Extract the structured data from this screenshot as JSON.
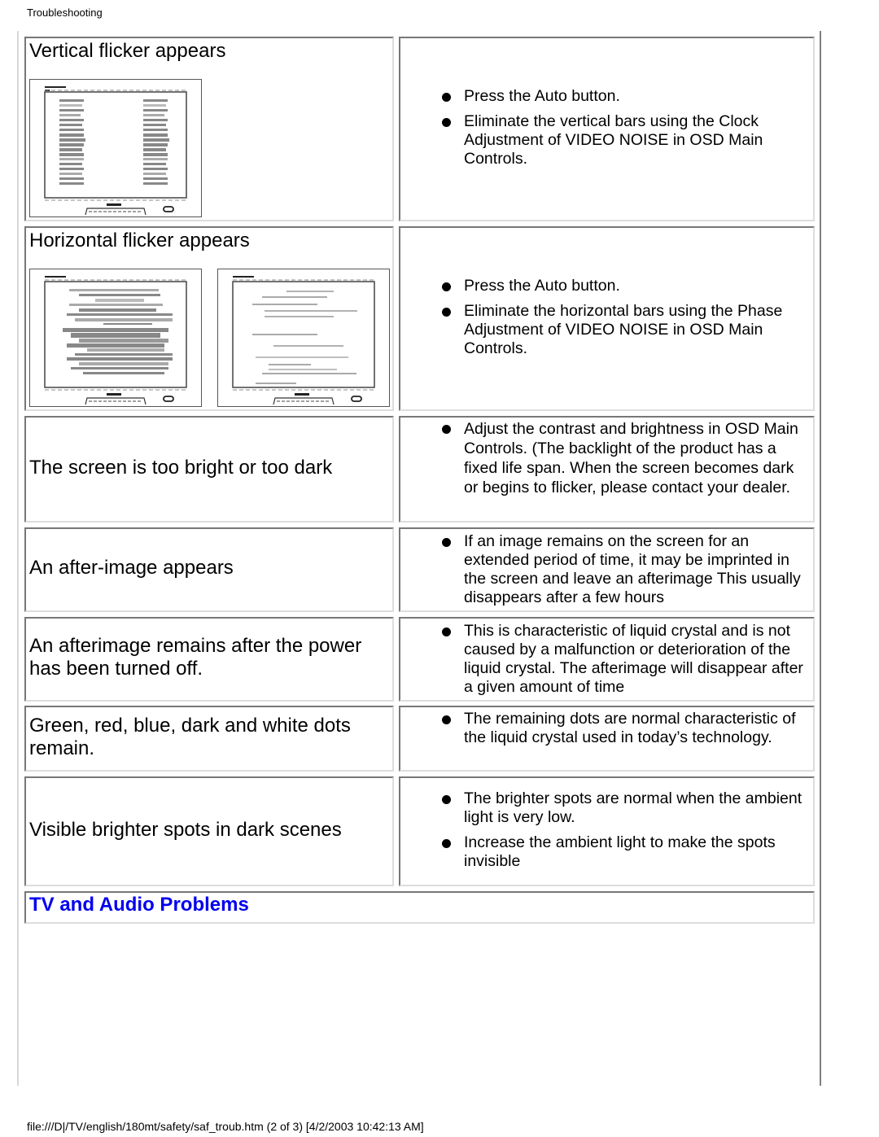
{
  "header": {
    "title": "Troubleshooting"
  },
  "rows": [
    {
      "problem": "Vertical flicker appears",
      "illustration": "monitor-vertical-flicker",
      "solutions": [
        "Press the Auto button.",
        "Eliminate the vertical bars using the Clock Adjustment of VIDEO NOISE in OSD Main Controls."
      ]
    },
    {
      "problem": "Horizontal flicker appears",
      "illustration": "monitor-horizontal-flicker",
      "solutions": [
        "Press the Auto button.",
        "Eliminate the horizontal bars using the Phase Adjustment of VIDEO NOISE in OSD Main Controls."
      ]
    },
    {
      "problem": "The screen is too bright or too dark",
      "solutions": [
        "Adjust the contrast and brightness in OSD Main Controls. (The backlight of the product has a fixed life span. When the screen becomes dark or begins to flicker, please contact your dealer."
      ]
    },
    {
      "problem": "An after-image appears",
      "solutions": [
        "If an image remains on the screen for an extended period of time, it may be imprinted in the screen and leave an afterimage This usually disappears after a few hours"
      ]
    },
    {
      "problem": "An afterimage remains after the power has been turned off.",
      "solutions": [
        "This is characteristic of liquid crystal and is not caused by a malfunction or deterioration of the liquid crystal. The afterimage will disappear after a given amount of time"
      ]
    },
    {
      "problem": "Green, red, blue, dark and white dots remain.",
      "solutions": [
        "The remaining dots are normal characteristic of the liquid crystal used in today’s technology."
      ]
    },
    {
      "problem": "Visible brighter spots in dark scenes",
      "solutions": [
        "The brighter spots are normal when the ambient light is very low.",
        "Increase the ambient light to make the spots invisible"
      ]
    }
  ],
  "section": {
    "heading": "TV and Audio Problems",
    "heading_color": "#0000ee"
  },
  "footer": {
    "text": "file:///D|/TV/english/180mt/safety/saf_troub.htm (2 of 3) [4/2/2003 10:42:13 AM]"
  },
  "icons": {
    "bullet": "filled-circle-bullet"
  }
}
